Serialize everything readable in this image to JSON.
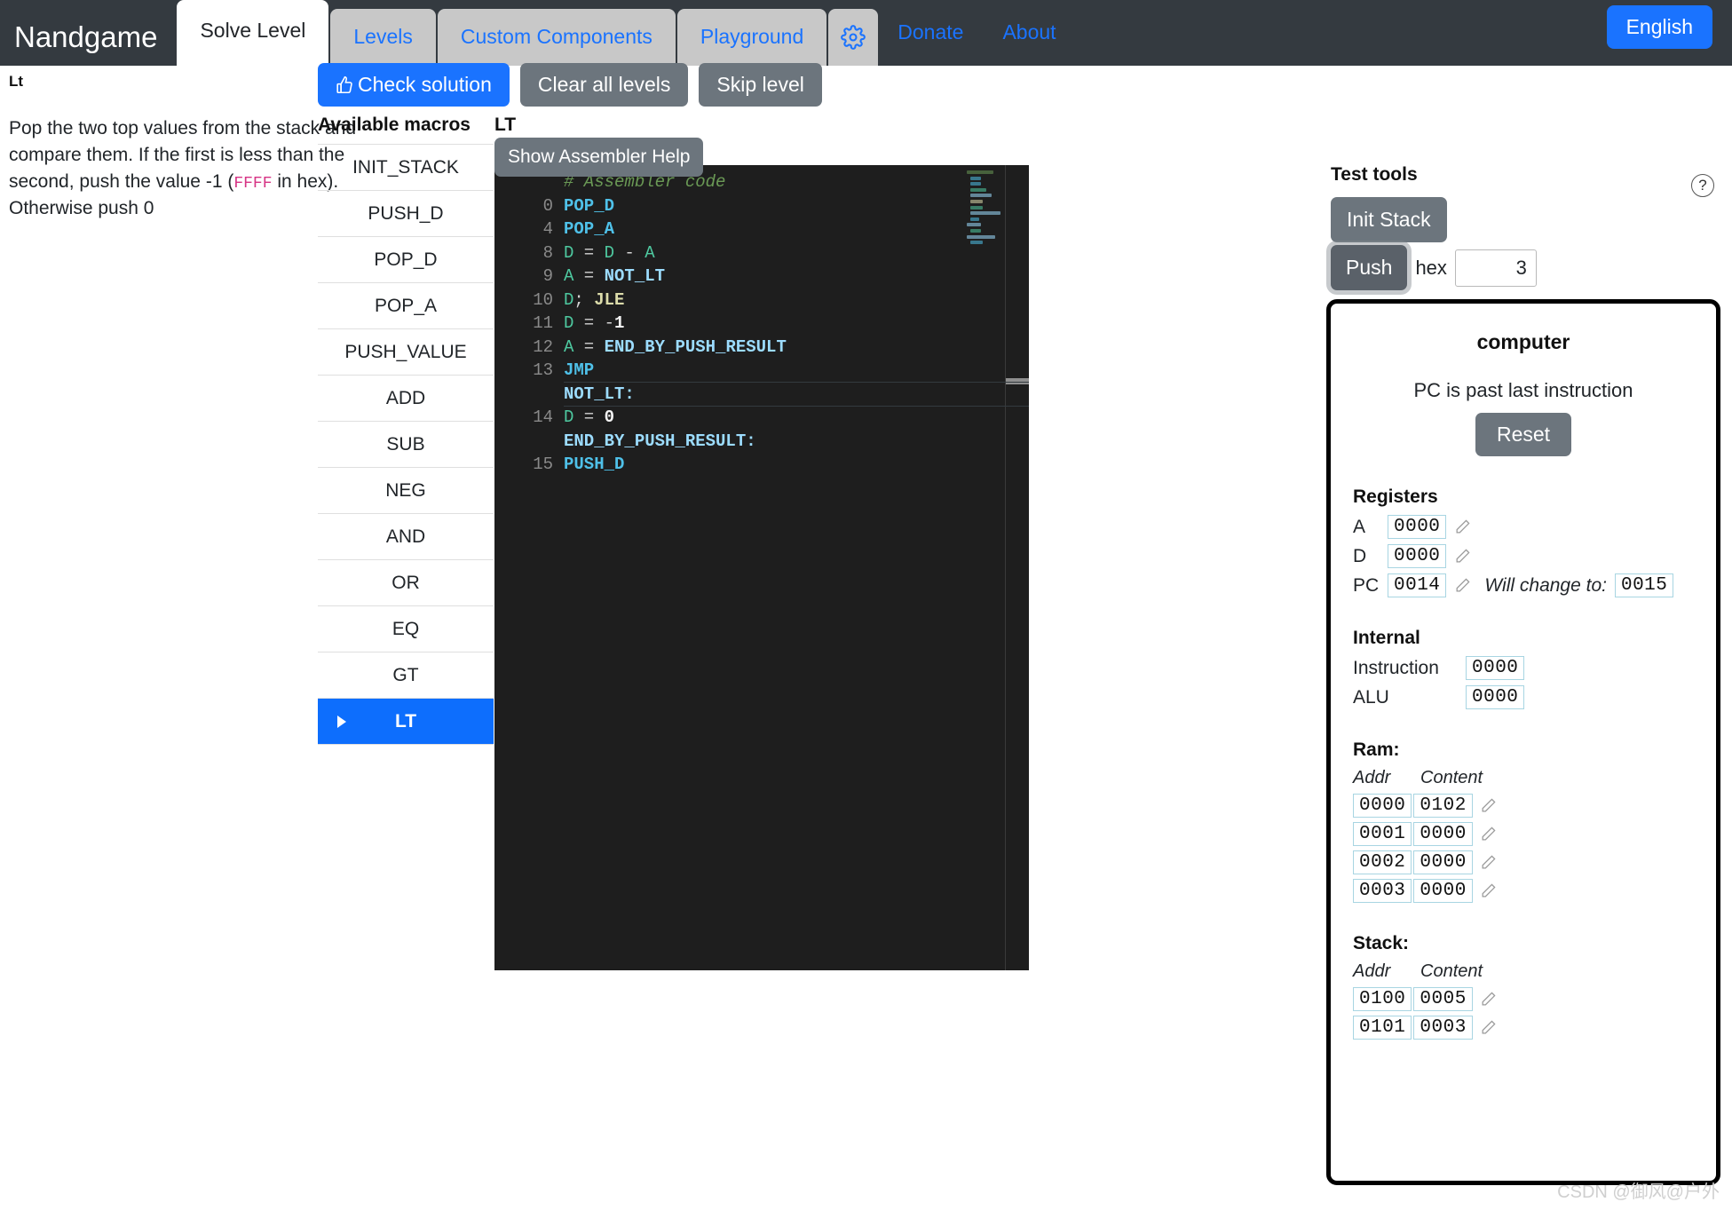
{
  "header": {
    "brand": "Nandgame",
    "tabs": [
      {
        "label": "Solve Level",
        "active": true
      },
      {
        "label": "Levels",
        "active": false
      },
      {
        "label": "Custom Components",
        "active": false
      },
      {
        "label": "Playground",
        "active": false
      }
    ],
    "gear_icon": "gear-icon",
    "links": [
      "Donate",
      "About"
    ],
    "language_button": "English"
  },
  "level": {
    "title": "Lt",
    "description_part1": "Pop the two top values from the stack and compare them. If the first is less than the second, push the value -1 (",
    "hex_value": "FFFF",
    "description_part2": " in hex). Otherwise push 0"
  },
  "toolbar": {
    "check_solution": "Check solution",
    "check_icon": "thumbs-up-icon",
    "clear_all_levels": "Clear all levels",
    "skip_level": "Skip level"
  },
  "macros": {
    "heading": "Available macros",
    "items": [
      "INIT_STACK",
      "PUSH_D",
      "POP_D",
      "POP_A",
      "PUSH_VALUE",
      "ADD",
      "SUB",
      "NEG",
      "AND",
      "OR",
      "EQ",
      "GT",
      "LT"
    ],
    "selected": "LT"
  },
  "editor": {
    "label": "LT",
    "assembler_help_button": "Show Assembler Help",
    "lines": [
      {
        "no": "",
        "kind": "comment",
        "text": "# Assembler code"
      },
      {
        "no": "0",
        "kind": "macro",
        "text": "POP_D"
      },
      {
        "no": "4",
        "kind": "macro",
        "text": "POP_A"
      },
      {
        "no": "8",
        "kind": "expr",
        "text": "D = D - A"
      },
      {
        "no": "9",
        "kind": "assign-label",
        "text": "A = NOT_LT"
      },
      {
        "no": "10",
        "kind": "jump",
        "text": "D; JLE"
      },
      {
        "no": "11",
        "kind": "num",
        "text": "D = -1"
      },
      {
        "no": "12",
        "kind": "assign-label",
        "text": "A = END_BY_PUSH_RESULT"
      },
      {
        "no": "13",
        "kind": "macro",
        "text": "JMP"
      },
      {
        "no": "",
        "kind": "label",
        "text": "NOT_LT:"
      },
      {
        "no": "14",
        "kind": "num",
        "text": "D = 0"
      },
      {
        "no": "",
        "kind": "label2",
        "text": "END_BY_PUSH_RESULT:"
      },
      {
        "no": "15",
        "kind": "macro",
        "text": "PUSH_D"
      }
    ]
  },
  "test_tools": {
    "heading": "Test tools",
    "help_icon": "question-mark-icon",
    "init_stack": "Init Stack",
    "push": "Push",
    "hex_label": "hex",
    "hex_value": "3"
  },
  "computer": {
    "title": "computer",
    "pc_status": "PC is past last instruction",
    "reset": "Reset",
    "registers_heading": "Registers",
    "registers": [
      {
        "name": "A",
        "value": "0000",
        "editable": true
      },
      {
        "name": "D",
        "value": "0000",
        "editable": true
      },
      {
        "name": "PC",
        "value": "0014",
        "editable": true,
        "will_change_label": "Will change to:",
        "will_change_value": "0015"
      }
    ],
    "internal_heading": "Internal",
    "internal": [
      {
        "name": "Instruction",
        "value": "0000"
      },
      {
        "name": "ALU",
        "value": "0000"
      }
    ],
    "ram_heading": "Ram:",
    "ram_columns": {
      "addr": "Addr",
      "content": "Content"
    },
    "ram_rows": [
      {
        "addr": "0000",
        "content": "0102"
      },
      {
        "addr": "0001",
        "content": "0000"
      },
      {
        "addr": "0002",
        "content": "0000"
      },
      {
        "addr": "0003",
        "content": "0000"
      }
    ],
    "stack_heading": "Stack:",
    "stack_columns": {
      "addr": "Addr",
      "content": "Content"
    },
    "stack_rows": [
      {
        "addr": "0100",
        "content": "0005"
      },
      {
        "addr": "0101",
        "content": "0003"
      }
    ]
  },
  "watermark": "CSDN @御风@户外",
  "colors": {
    "header_bg": "#343a40",
    "accent_blue": "#1a73ff",
    "tab_inactive_bg": "#c8c8c8",
    "secondary_gray": "#6c757d",
    "editor_bg": "#1e1e1e",
    "hex_pink": "#d63384",
    "hexbox_border": "#a8d5e2"
  }
}
